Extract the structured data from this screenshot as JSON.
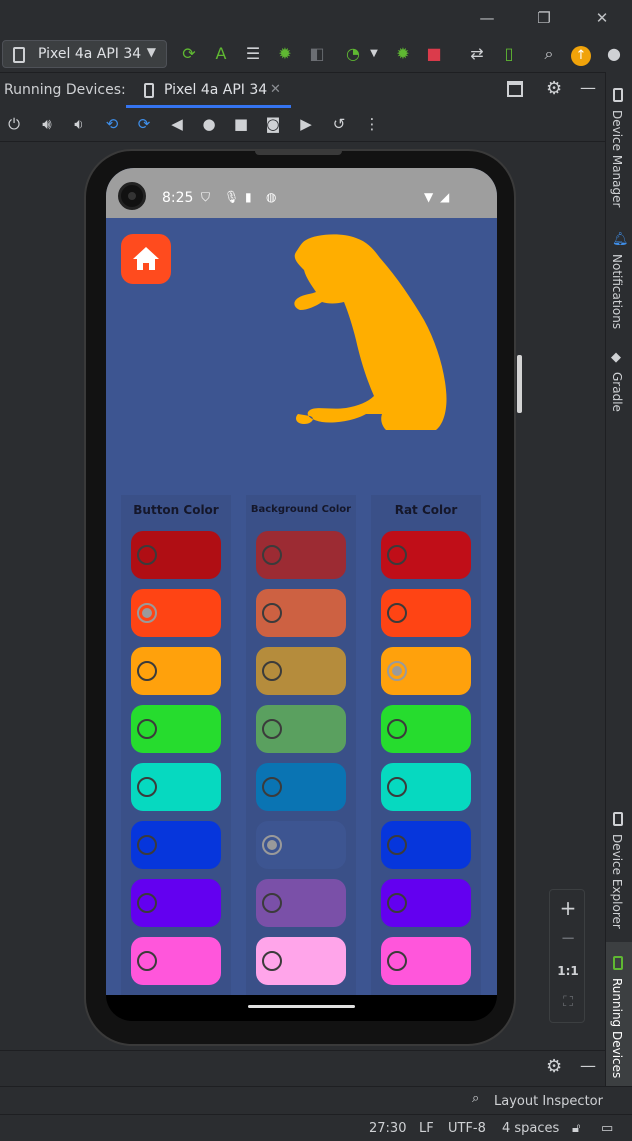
{
  "toolbar": {
    "device_selector": "Pixel 4a API 34"
  },
  "running_devices": {
    "title": "Running Devices:",
    "tab_label": "Pixel 4a API 34"
  },
  "right_sidebar": {
    "device_manager": "Device Manager",
    "notifications": "Notifications",
    "gradle": "Gradle",
    "device_explorer": "Device Explorer",
    "running_devices": "Running Devices"
  },
  "phone": {
    "status_time": "8:25",
    "columns": [
      {
        "header": "Button Color",
        "swatches": [
          {
            "color": "#b00e14",
            "selected": false
          },
          {
            "color": "#ff4414",
            "selected": true
          },
          {
            "color": "#ffa10c",
            "selected": false
          },
          {
            "color": "#26dc2e",
            "selected": false
          },
          {
            "color": "#06d9c0",
            "selected": false
          },
          {
            "color": "#0636dc",
            "selected": false
          },
          {
            "color": "#6300f0",
            "selected": false
          },
          {
            "color": "#ff56db",
            "selected": false
          }
        ]
      },
      {
        "header": "Background Color",
        "swatches": [
          {
            "color": "#9c2b33",
            "selected": false
          },
          {
            "color": "#cd6142",
            "selected": false
          },
          {
            "color": "#b58c3c",
            "selected": false
          },
          {
            "color": "#5aa05f",
            "selected": false
          },
          {
            "color": "#0a74b3",
            "selected": false
          },
          {
            "color": "#3d5591",
            "selected": true
          },
          {
            "color": "#7a50a8",
            "selected": false
          },
          {
            "color": "#ffa5ea",
            "selected": false
          }
        ]
      },
      {
        "header": "Rat Color",
        "swatches": [
          {
            "color": "#c00e18",
            "selected": false
          },
          {
            "color": "#ff4414",
            "selected": false
          },
          {
            "color": "#ffa10c",
            "selected": true
          },
          {
            "color": "#26dc2e",
            "selected": false
          },
          {
            "color": "#06d9c0",
            "selected": false
          },
          {
            "color": "#0636dc",
            "selected": false
          },
          {
            "color": "#6300f0",
            "selected": false
          },
          {
            "color": "#ff56db",
            "selected": false
          }
        ]
      }
    ],
    "rat_color": "#ffae00",
    "home_button_color": "#ff4b1e"
  },
  "zoom_panel": {
    "zoom_in": "+",
    "zoom_out": "−",
    "actual_size": "1:1"
  },
  "layout_inspector": "Layout Inspector",
  "statusbar": {
    "position": "27:30",
    "line_sep": "LF",
    "encoding": "UTF-8",
    "indent": "4 spaces"
  }
}
